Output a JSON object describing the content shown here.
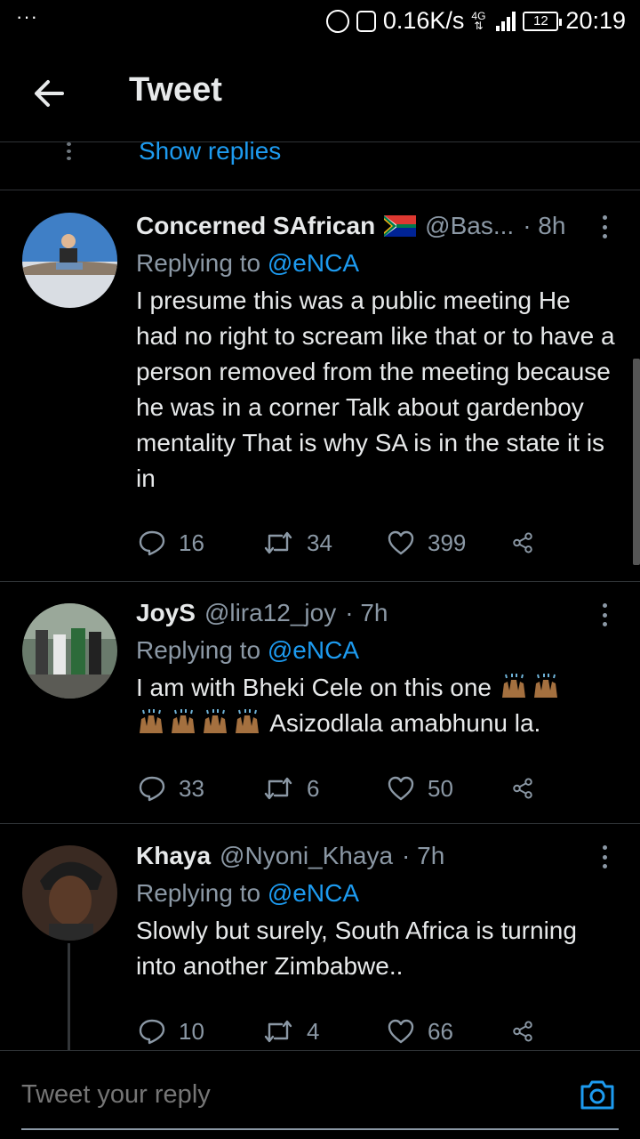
{
  "status_bar": {
    "dots": "···",
    "net_speed": "0.16K/s",
    "network": "4G",
    "battery": "12",
    "time": "20:19"
  },
  "header": {
    "title": "Tweet"
  },
  "thread": {
    "show_replies": "Show replies"
  },
  "tweets": [
    {
      "name": "Concerned SAfrican",
      "handle": "@Bas...",
      "time": "· 8h",
      "replying_prefix": "Replying to ",
      "replying_to": "@eNCA",
      "text": "I presume this was a public meeting He had no right to scream like that or to have a person removed from the meeting because he was in a corner Talk about gardenboy mentality That is why SA is in the state it is in",
      "replies": "16",
      "retweets": "34",
      "likes": "399"
    },
    {
      "name": "JoyS",
      "handle": "@lira12_joy",
      "time": "· 7h",
      "replying_prefix": "Replying to ",
      "replying_to": "@eNCA",
      "text_before": "I am with Bheki Cele on this one",
      "text_after": "Asizodlala amabhunu la.",
      "replies": "33",
      "retweets": "6",
      "likes": "50"
    },
    {
      "name": "Khaya",
      "handle": "@Nyoni_Khaya",
      "time": "· 7h",
      "replying_prefix": "Replying to ",
      "replying_to": "@eNCA",
      "text": "Slowly but surely, South Africa is turning into another Zimbabwe..",
      "replies": "10",
      "retweets": "4",
      "likes": "66"
    }
  ],
  "reply_bar": {
    "placeholder": "Tweet your reply"
  },
  "colors": {
    "accent": "#1d9bf0",
    "muted": "#8b98a5",
    "background": "#000000",
    "divider": "#2f3336"
  }
}
